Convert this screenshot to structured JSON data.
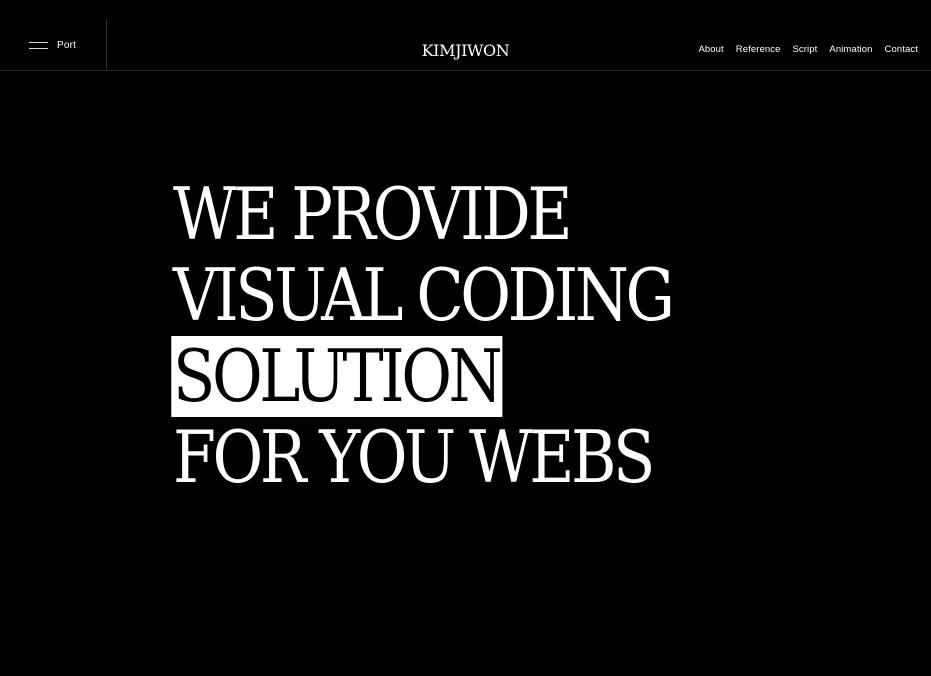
{
  "header": {
    "menu_label": "Port",
    "logo": "KIMJIWON",
    "nav": [
      "About",
      "Reference",
      "Script",
      "Animation",
      "Contact"
    ]
  },
  "hero": {
    "lines": [
      "WE PROVIDE",
      "VISUAL CODING",
      "SOLUTION",
      "FOR YOU WEBS"
    ],
    "highlighted_line": "SOLUTION"
  },
  "colors": {
    "background": "#000000",
    "text": "#ffffff",
    "highlight_bg": "#ffffff",
    "highlight_text": "#000000",
    "divider": "#2a2a2a"
  },
  "icons": {
    "menu": "hamburger-icon"
  }
}
